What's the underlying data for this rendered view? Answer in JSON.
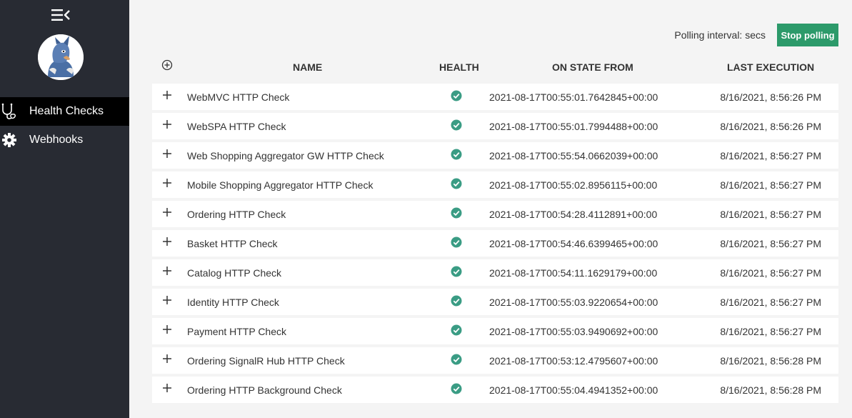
{
  "sidebar": {
    "nav": [
      {
        "label": "Health Checks",
        "icon": "stethoscope-icon",
        "active": true
      },
      {
        "label": "Webhooks",
        "icon": "gear-icon",
        "active": false
      }
    ]
  },
  "toolbar": {
    "polling_text": "Polling interval: secs",
    "stop_label": "Stop polling",
    "accent": "#2c9a6a"
  },
  "table": {
    "headers": {
      "name": "NAME",
      "health": "HEALTH",
      "since": "ON STATE FROM",
      "last": "LAST EXECUTION"
    },
    "rows": [
      {
        "name": "WebMVC HTTP Check",
        "since": "2021-08-17T00:55:01.7642845+00:00",
        "last": "8/16/2021, 8:56:26 PM"
      },
      {
        "name": "WebSPA HTTP Check",
        "since": "2021-08-17T00:55:01.7994488+00:00",
        "last": "8/16/2021, 8:56:26 PM"
      },
      {
        "name": "Web Shopping Aggregator GW HTTP Check",
        "since": "2021-08-17T00:55:54.0662039+00:00",
        "last": "8/16/2021, 8:56:27 PM"
      },
      {
        "name": "Mobile Shopping Aggregator HTTP Check",
        "since": "2021-08-17T00:55:02.8956115+00:00",
        "last": "8/16/2021, 8:56:27 PM"
      },
      {
        "name": "Ordering HTTP Check",
        "since": "2021-08-17T00:54:28.4112891+00:00",
        "last": "8/16/2021, 8:56:27 PM"
      },
      {
        "name": "Basket HTTP Check",
        "since": "2021-08-17T00:54:46.6399465+00:00",
        "last": "8/16/2021, 8:56:27 PM"
      },
      {
        "name": "Catalog HTTP Check",
        "since": "2021-08-17T00:54:11.1629179+00:00",
        "last": "8/16/2021, 8:56:27 PM"
      },
      {
        "name": "Identity HTTP Check",
        "since": "2021-08-17T00:55:03.9220654+00:00",
        "last": "8/16/2021, 8:56:27 PM"
      },
      {
        "name": "Payment HTTP Check",
        "since": "2021-08-17T00:55:03.9490692+00:00",
        "last": "8/16/2021, 8:56:27 PM"
      },
      {
        "name": "Ordering SignalR Hub HTTP Check",
        "since": "2021-08-17T00:53:12.4795607+00:00",
        "last": "8/16/2021, 8:56:28 PM"
      },
      {
        "name": "Ordering HTTP Background Check",
        "since": "2021-08-17T00:55:04.4941352+00:00",
        "last": "8/16/2021, 8:56:28 PM"
      }
    ],
    "health_color": "#3a9c84"
  }
}
